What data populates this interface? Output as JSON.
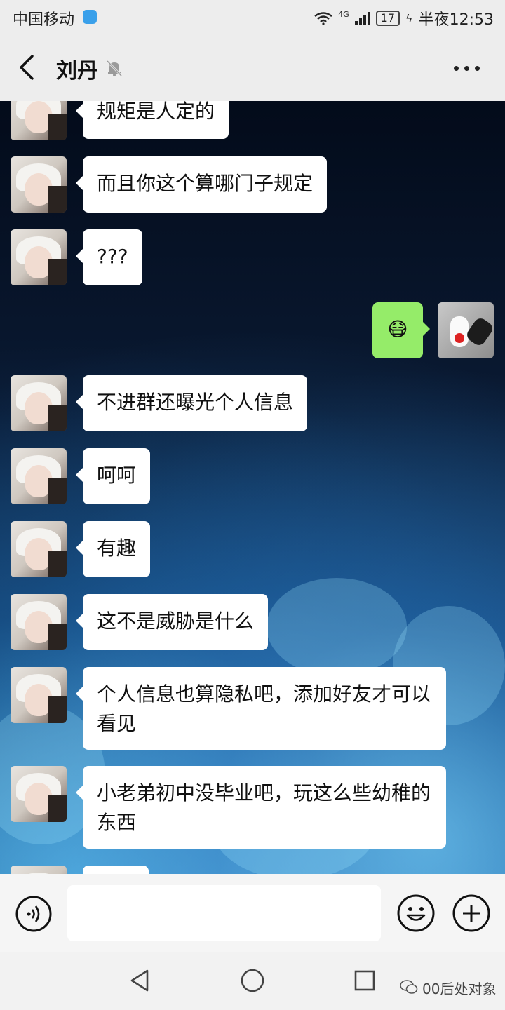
{
  "status_bar": {
    "carrier": "中国移动",
    "network": "4G",
    "battery": "17",
    "time": "半夜12:53"
  },
  "header": {
    "contact_name": "刘丹"
  },
  "messages": [
    {
      "from": "other",
      "text": "规矩是人定的"
    },
    {
      "from": "other",
      "text": "而且你这个算哪门子规定"
    },
    {
      "from": "other",
      "text": "???"
    },
    {
      "from": "me",
      "text": "😷"
    },
    {
      "from": "other",
      "text": "不进群还曝光个人信息"
    },
    {
      "from": "other",
      "text": "呵呵"
    },
    {
      "from": "other",
      "text": "有趣"
    },
    {
      "from": "other",
      "text": "这不是威胁是什么"
    },
    {
      "from": "other",
      "text": "个人信息也算隐私吧，添加好友才可以看见"
    },
    {
      "from": "other",
      "text": "小老弟初中没毕业吧，玩这么些幼稚的东西"
    }
  ],
  "input": {
    "value": ""
  },
  "watermark": "00后处对象",
  "colors": {
    "my_bubble": "#95ec69",
    "other_bubble": "#ffffff",
    "bar_bg": "#ededed"
  }
}
